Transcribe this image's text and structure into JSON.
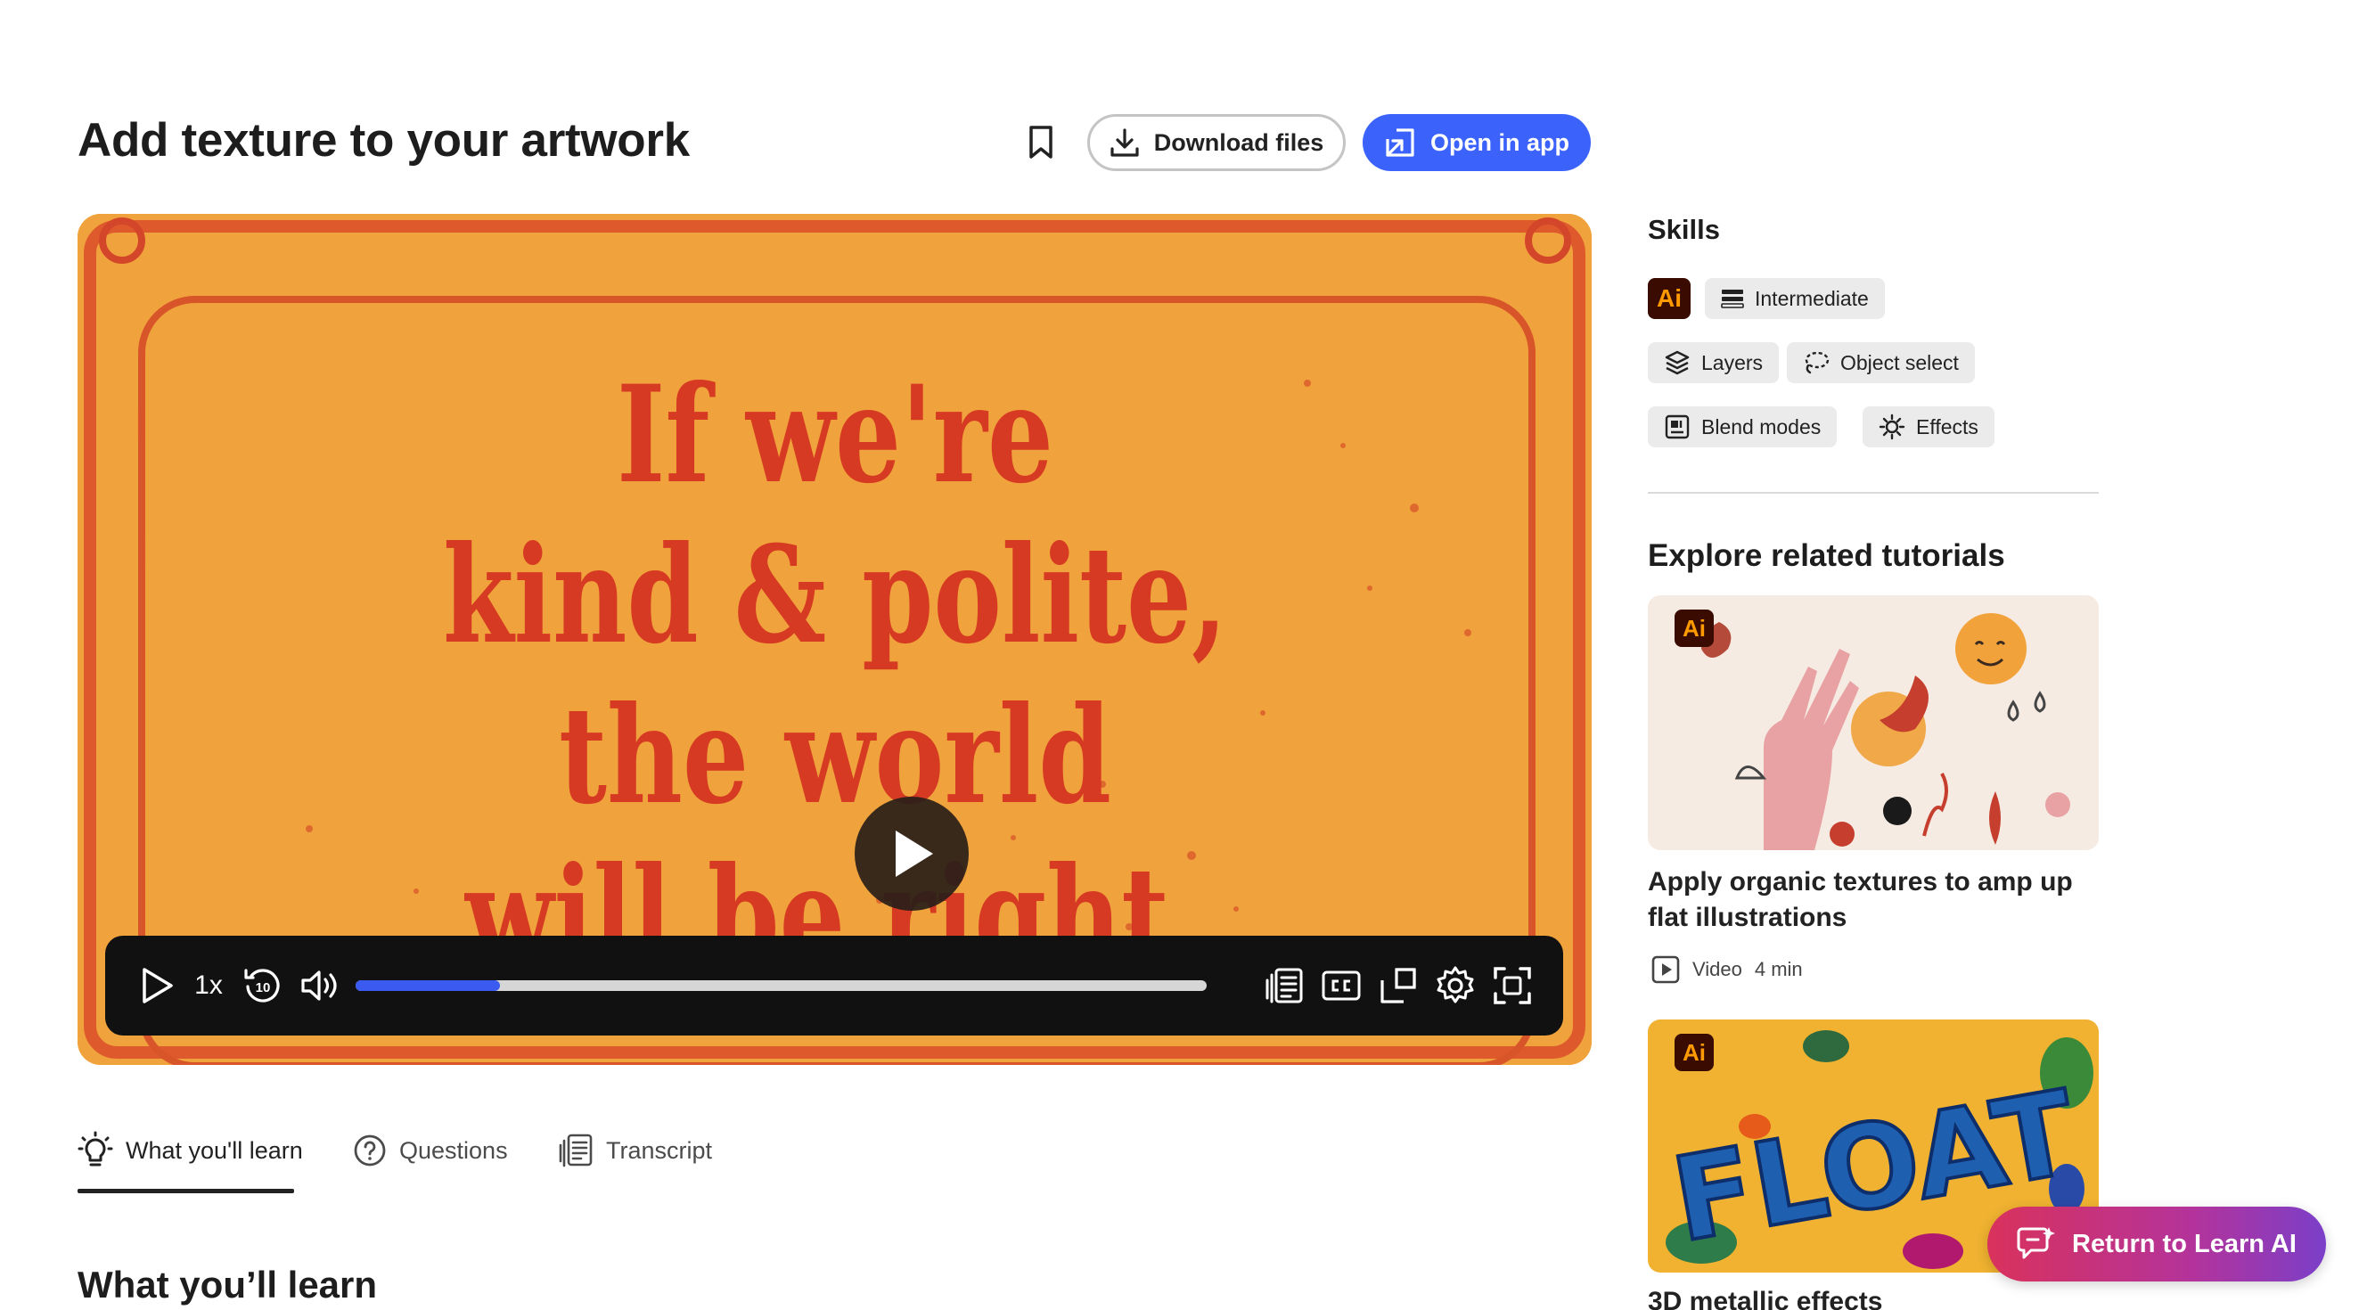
{
  "header": {
    "title": "Add texture to your artwork",
    "download_label": "Download files",
    "open_label": "Open in app"
  },
  "video": {
    "poster_lines": [
      "If we're",
      "kind & polite,",
      "the world",
      "will be right."
    ],
    "speed": "1x",
    "skip_seconds": "10",
    "progress": 0.17
  },
  "tabs": [
    {
      "label": "What you'll learn",
      "icon": "lightbulb-icon",
      "active": true
    },
    {
      "label": "Questions",
      "icon": "question-circle-icon",
      "active": false
    },
    {
      "label": "Transcript",
      "icon": "transcript-icon",
      "active": false
    }
  ],
  "learn_section_title": "What you’ll learn",
  "skills": {
    "title": "Skills",
    "app_badge": "Ai",
    "level": "Intermediate",
    "tags": [
      {
        "label": "Layers",
        "icon": "layers-icon"
      },
      {
        "label": "Object select",
        "icon": "lasso-icon"
      },
      {
        "label": "Blend modes",
        "icon": "blend-modes-icon"
      },
      {
        "label": "Effects",
        "icon": "sun-effects-icon"
      }
    ]
  },
  "related": {
    "title": "Explore related tutorials",
    "cards": [
      {
        "app_badge": "Ai",
        "title": "Apply organic textures to amp up flat illustrations",
        "type": "Video",
        "duration": "4 min"
      },
      {
        "app_badge": "Ai",
        "title": "3D metallic effects",
        "thumb_text": "FLOAT"
      }
    ]
  },
  "floating": {
    "return_label": "Return to Learn AI"
  },
  "colors": {
    "accent": "#3b63fb",
    "video_bg": "#f0a23c",
    "poster_text": "#d63a22",
    "app_badge_bg": "#3a0b00",
    "app_badge_fg": "#ff9a00"
  }
}
